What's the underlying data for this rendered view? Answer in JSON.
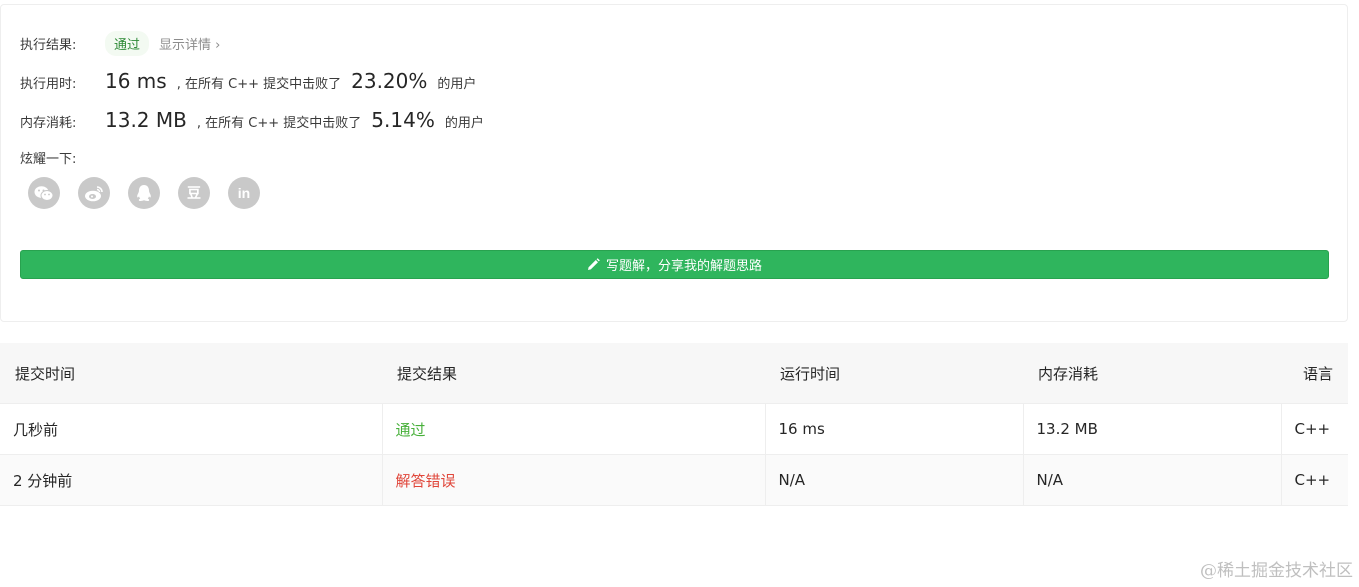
{
  "result": {
    "label": "执行结果:",
    "status": "通过",
    "detail_link": "显示详情 ›"
  },
  "runtime": {
    "label": "执行用时:",
    "value": "16 ms",
    "prefix": ", 在所有 C++ 提交中击败了",
    "percent": "23.20%",
    "suffix": "的用户"
  },
  "memory": {
    "label": "内存消耗:",
    "value": "13.2 MB",
    "prefix": ", 在所有 C++ 提交中击败了",
    "percent": "5.14%",
    "suffix": "的用户"
  },
  "share": {
    "label": "炫耀一下:",
    "icons": [
      "wechat-icon",
      "weibo-icon",
      "qq-icon",
      "douban-icon",
      "linkedin-icon"
    ],
    "douban_glyph": "豆",
    "linkedin_glyph": "in"
  },
  "write_solution": {
    "label": "写题解，分享我的解题思路"
  },
  "table": {
    "headers": [
      "提交时间",
      "提交结果",
      "运行时间",
      "内存消耗",
      "语言"
    ],
    "rows": [
      {
        "time": "几秒前",
        "result": "通过",
        "runtime": "16 ms",
        "memory": "13.2 MB",
        "lang": "C++"
      },
      {
        "time": "2 分钟前",
        "result": "解答错误",
        "runtime": "N/A",
        "memory": "N/A",
        "lang": "C++"
      }
    ]
  },
  "colors": {
    "accent_green": "#2fb55d",
    "pass_green": "#47b03a",
    "error_red": "#e0463a",
    "icon_gray": "#c9c9c9"
  },
  "watermark": "@稀土掘金技术社区"
}
